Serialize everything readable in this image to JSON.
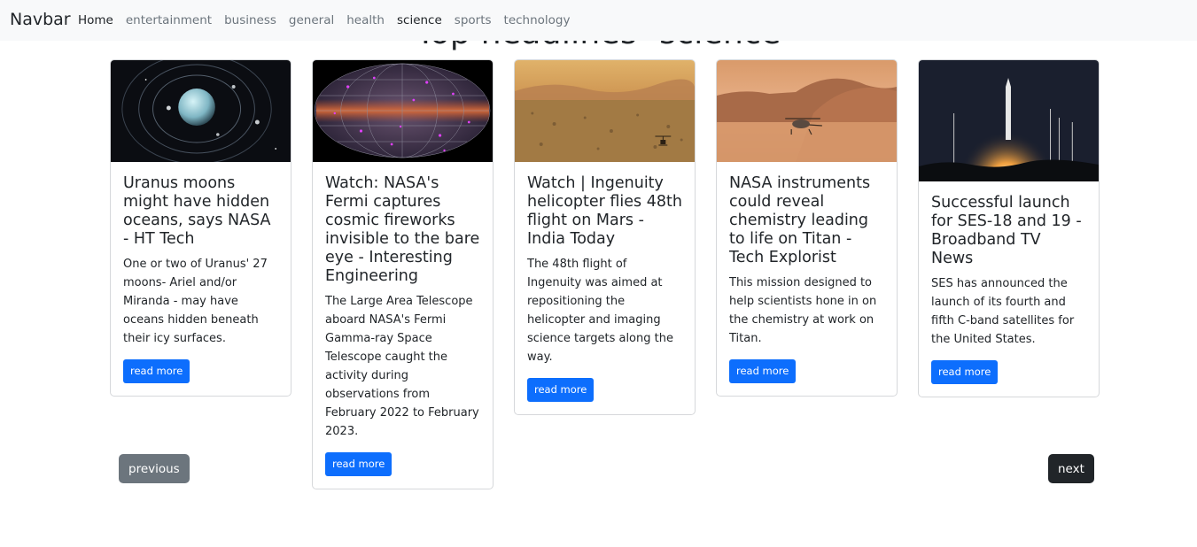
{
  "navbar": {
    "brand": "Navbar",
    "links": [
      {
        "label": "Home",
        "active": true
      },
      {
        "label": "entertainment"
      },
      {
        "label": "business"
      },
      {
        "label": "general"
      },
      {
        "label": "health"
      },
      {
        "label": "science",
        "active": true
      },
      {
        "label": "sports"
      },
      {
        "label": "technology"
      }
    ]
  },
  "page_heading": "Top headlines- science",
  "articles": [
    {
      "image": "uranus-moons-image",
      "title": "Uranus moons might have hidden oceans, says NASA - HT Tech",
      "description": "One or two of Uranus' 27 moons- Ariel and/or Miranda - may have oceans hidden beneath their icy surfaces.",
      "button": "read more"
    },
    {
      "image": "fermi-sky-map-image",
      "title": "Watch: NASA's Fermi captures cosmic fireworks invisible to the bare eye - Interesting Engineering",
      "description": "The Large Area Telescope aboard NASA's Fermi Gamma-ray Space Telescope caught the activity during observations from February 2022 to February 2023.",
      "button": "read more"
    },
    {
      "image": "mars-ingenuity-image",
      "title": "Watch | Ingenuity helicopter flies 48th flight on Mars - India Today",
      "description": "The 48th flight of Ingenuity was aimed at repositioning the helicopter and imaging science targets along the way.",
      "button": "read more"
    },
    {
      "image": "titan-dragonfly-image",
      "title": "NASA instruments could reveal chemistry leading to life on Titan - Tech Explorist",
      "description": "This mission designed to help scientists hone in on the chemistry at work on Titan.",
      "button": "read more"
    },
    {
      "image": "rocket-launch-image",
      "title": "Successful launch for SES-18 and 19 - Broadband TV News",
      "description": "SES has announced the launch of its fourth and fifth C-band satellites for the United States.",
      "button": "read more"
    }
  ],
  "pagination": {
    "previous": "previous",
    "next": "next"
  },
  "colors": {
    "primary": "#0d6efd",
    "secondary": "#6c757d",
    "dark": "#212529",
    "navbar_bg": "#f8f9fa"
  }
}
